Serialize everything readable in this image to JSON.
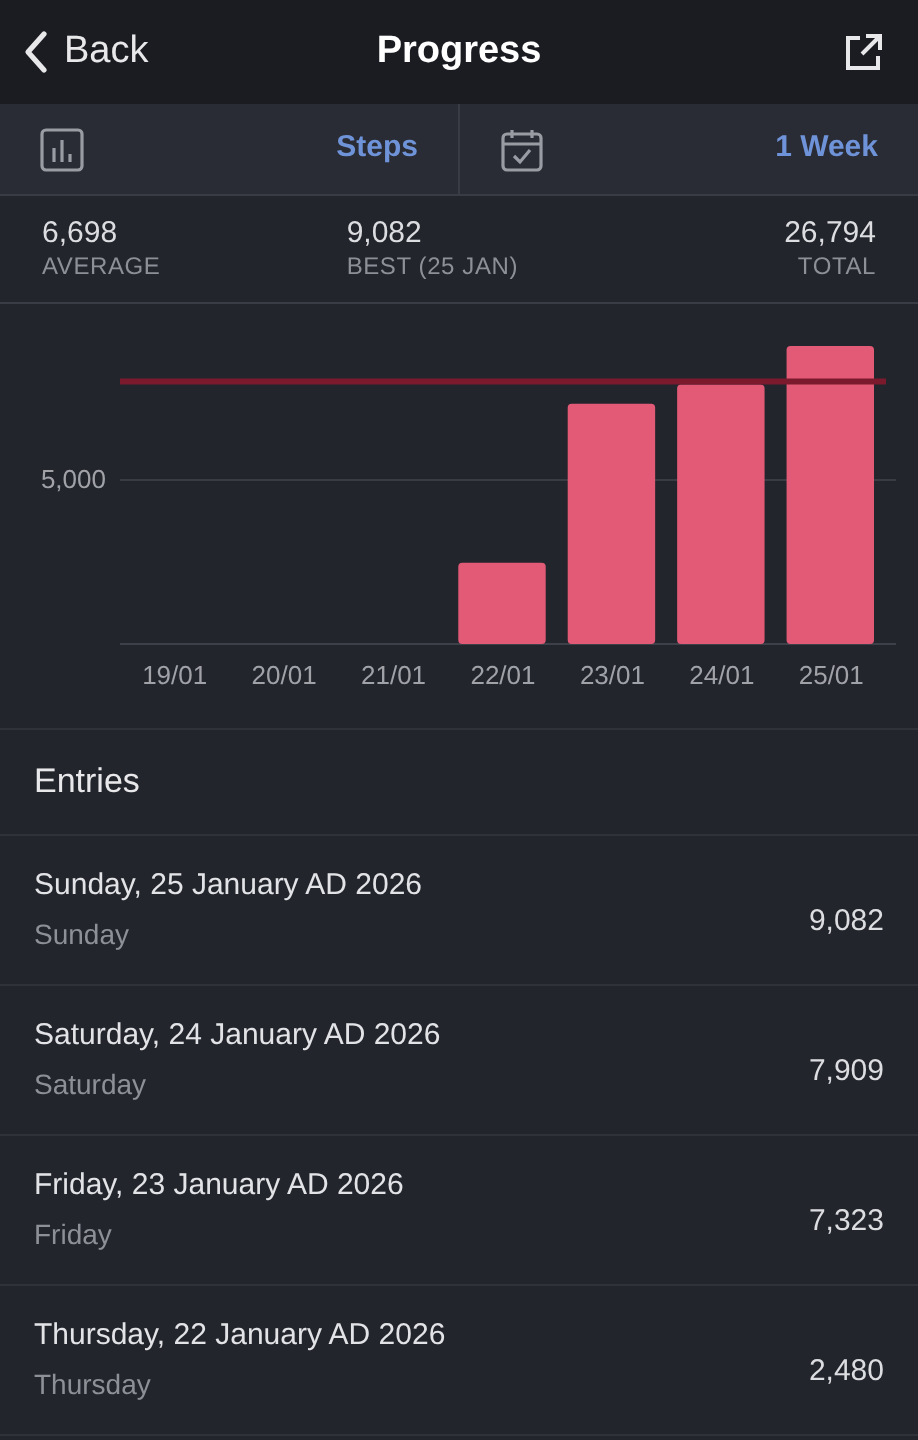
{
  "nav": {
    "back": "Back",
    "title": "Progress"
  },
  "toolbar": {
    "metric": "Steps",
    "period": "1 Week"
  },
  "stats": [
    {
      "value": "6,698",
      "label": "AVERAGE"
    },
    {
      "value": "9,082",
      "label": "BEST (25 JAN)"
    },
    {
      "value": "26,794",
      "label": "TOTAL"
    }
  ],
  "chart": {
    "gridline_label": "5,000",
    "x_labels": [
      "19/01",
      "20/01",
      "21/01",
      "22/01",
      "23/01",
      "24/01",
      "25/01"
    ]
  },
  "entries_title": "Entries",
  "entries": [
    {
      "date": "Sunday, 25 January AD 2026",
      "day": "Sunday",
      "value": "9,082"
    },
    {
      "date": "Saturday, 24 January AD 2026",
      "day": "Saturday",
      "value": "7,909"
    },
    {
      "date": "Friday, 23 January AD 2026",
      "day": "Friday",
      "value": "7,323"
    },
    {
      "date": "Thursday, 22 January AD 2026",
      "day": "Thursday",
      "value": "2,480"
    }
  ]
}
